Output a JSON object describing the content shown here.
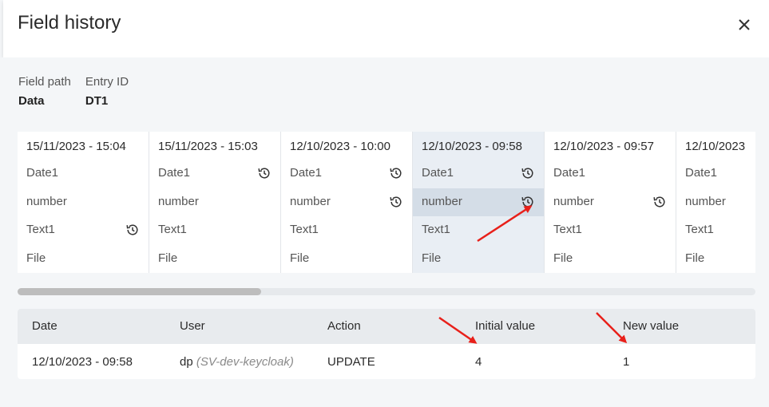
{
  "dialog": {
    "title": "Field history",
    "close_icon": "close-icon"
  },
  "meta": [
    {
      "label": "Field path",
      "value": "Data"
    },
    {
      "label": "Entry ID",
      "value": "DT1"
    }
  ],
  "history_columns": [
    {
      "timestamp": "15/11/2023 - 15:04",
      "fields": [
        "Date1",
        "number",
        "Text1",
        "File"
      ],
      "changed": [
        false,
        false,
        true,
        false
      ],
      "selected": false
    },
    {
      "timestamp": "15/11/2023 - 15:03",
      "fields": [
        "Date1",
        "number",
        "Text1",
        "File"
      ],
      "changed": [
        true,
        false,
        false,
        false
      ],
      "selected": false
    },
    {
      "timestamp": "12/10/2023 - 10:00",
      "fields": [
        "Date1",
        "number",
        "Text1",
        "File"
      ],
      "changed": [
        true,
        true,
        false,
        false
      ],
      "selected": false
    },
    {
      "timestamp": "12/10/2023 - 09:58",
      "fields": [
        "Date1",
        "number",
        "Text1",
        "File"
      ],
      "changed": [
        true,
        true,
        false,
        false
      ],
      "selected": true,
      "highlighted_field": 1
    },
    {
      "timestamp": "12/10/2023 - 09:57",
      "fields": [
        "Date1",
        "number",
        "Text1",
        "File"
      ],
      "changed": [
        false,
        true,
        false,
        false
      ],
      "selected": false
    },
    {
      "timestamp": "12/10/2023",
      "fields": [
        "Date1",
        "number",
        "Text1",
        "File"
      ],
      "changed": [
        false,
        false,
        false,
        false
      ],
      "selected": false
    }
  ],
  "table": {
    "headers": {
      "date": "Date",
      "user": "User",
      "action": "Action",
      "initial": "Initial value",
      "new": "New value"
    },
    "rows": [
      {
        "date": "12/10/2023 - 09:58",
        "user": "dp",
        "user_system": "(SV-dev-keycloak)",
        "action": "UPDATE",
        "initial": "4",
        "new": "1"
      }
    ]
  },
  "colors": {
    "accent_arrow": "#e8201a",
    "selected_column": "#e9eef4",
    "highlighted_cell": "#d4dde7"
  }
}
